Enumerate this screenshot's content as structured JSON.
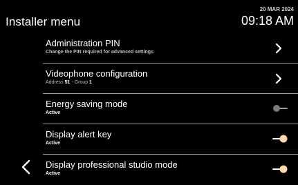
{
  "header": {
    "title": "Installer menu",
    "date": "20 MAR 2024",
    "time": "09:18 AM"
  },
  "items": [
    {
      "title": "Administration PIN",
      "subtitle": "Change the PIN required for advanced settings",
      "control": "chevron"
    },
    {
      "title": "Videophone configuration",
      "subtitle_prefix": "Address ",
      "address": "51",
      "subtitle_mid": " - Group ",
      "group": "1",
      "control": "chevron"
    },
    {
      "title": "Energy saving mode",
      "status": "Active",
      "control": "toggle",
      "toggle_on": false
    },
    {
      "title": "Display alert key",
      "status": "Active",
      "control": "toggle",
      "toggle_on": true
    },
    {
      "title": "Display professional studio mode",
      "status": "Active",
      "control": "toggle",
      "toggle_on": true
    }
  ],
  "icons": {
    "back": "chevron-left-icon",
    "next": "chevron-right-icon",
    "toggle": "toggle-switch-icon"
  },
  "colors": {
    "background": "#000000",
    "text": "#ffffff",
    "divider": "#9a9a9a",
    "toggle_on_knob": "#ffd9a8",
    "toggle_off": "#7a7a7a"
  }
}
